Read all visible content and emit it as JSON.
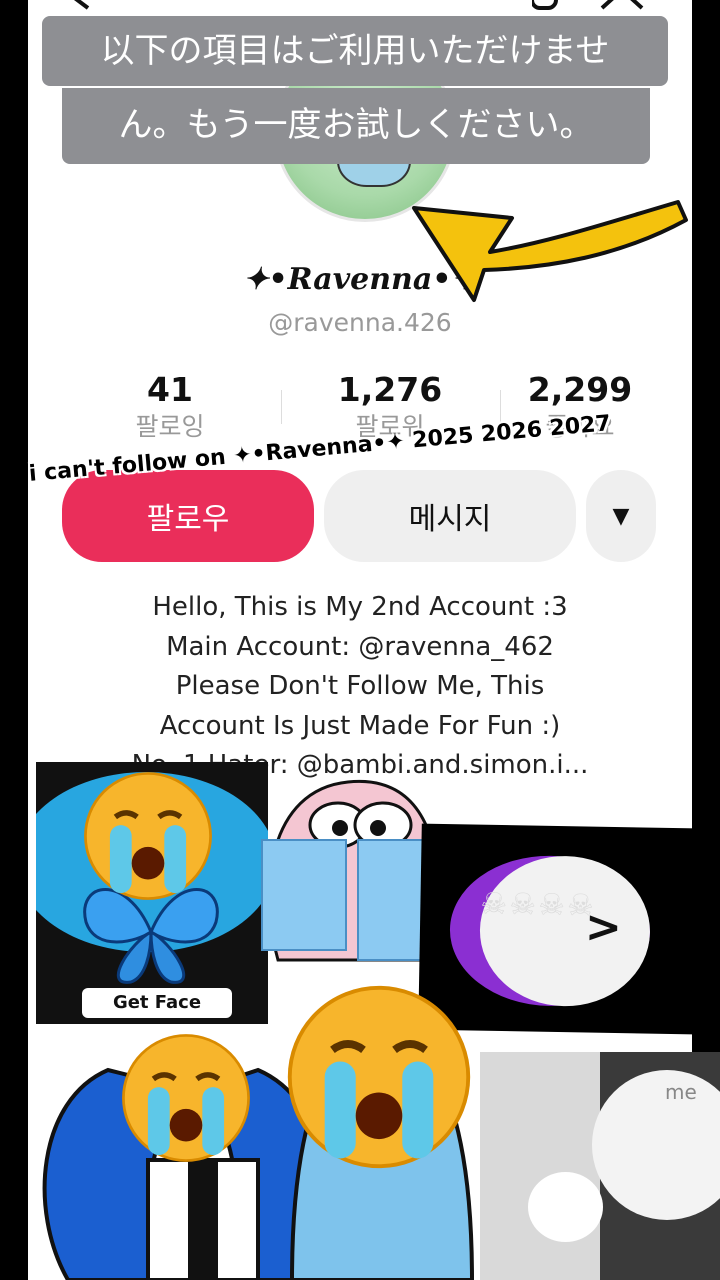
{
  "toast": {
    "line1": "以下の項目はご利用いただけませ",
    "line2": "ん。もう一度お試しください。"
  },
  "profile": {
    "display_name": "✦•Ravenna•✦",
    "handle": "@ravenna.426"
  },
  "stats": [
    {
      "value": "41",
      "label": "팔로잉"
    },
    {
      "value": "1,276",
      "label": "팔로워"
    },
    {
      "value": "2,299",
      "label": "좋아요"
    }
  ],
  "buttons": {
    "follow": "팔로우",
    "message": "메시지",
    "more": "▼"
  },
  "bio": [
    "Hello, This is My 2nd Account :3",
    "Main Account: @ravenna_462",
    "Please Don't Follow Me, This",
    "Account Is Just Made For Fun :)",
    "No. 1 Hater: @bambi.and.simon.i..."
  ],
  "overlay_caption": "i can't follow on ✦•Ravenna•✦  2025 2026 2027",
  "stickers": {
    "faceMoji_caption": "Get Face moji!!",
    "me_label": "me",
    "skulls": "☠☠☠☠"
  },
  "colors": {
    "follow_button": "#ea2e5a",
    "toast_bg": "#8e8f93",
    "arrow": "#f4c20d"
  }
}
